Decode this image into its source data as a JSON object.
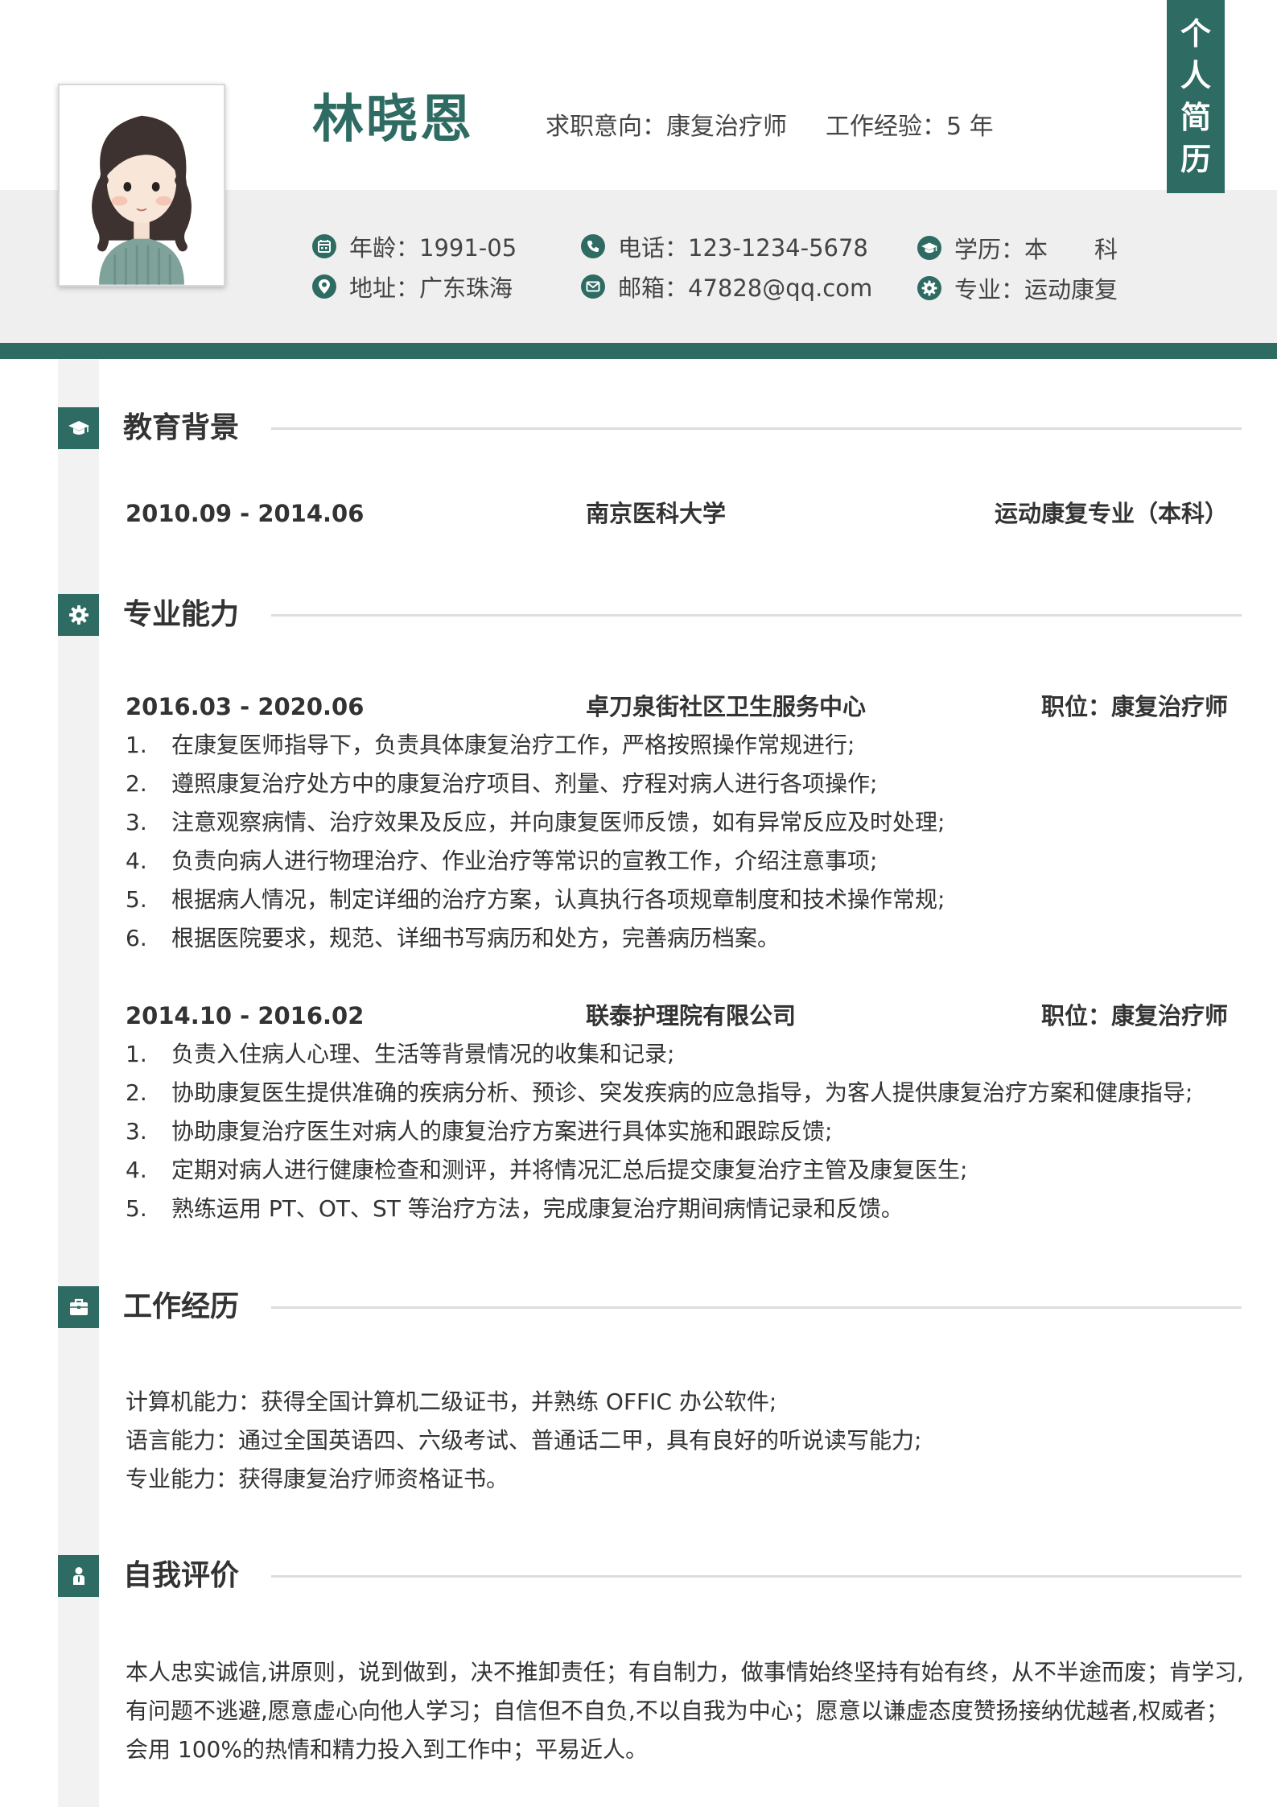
{
  "header": {
    "name": "林晓恩",
    "intent": "求职意向：康复治疗师",
    "experience": "工作经验：5 年",
    "tag": [
      "个",
      "人",
      "简",
      "历"
    ],
    "info": [
      {
        "icon": "calendar-icon",
        "text": "年龄：1991-05"
      },
      {
        "icon": "location-pin-icon",
        "text": "地址：广东珠海"
      },
      {
        "icon": "phone-icon",
        "text": "电话：123-1234-5678"
      },
      {
        "icon": "envelope-icon",
        "text": "邮箱：47828@qq.com"
      },
      {
        "icon": "graduation-cap-icon",
        "text": "学历：本　　科"
      },
      {
        "icon": "gear-icon",
        "text": "专业：运动康复"
      }
    ]
  },
  "sections": {
    "education": {
      "title": "教育背景",
      "icon": "graduation-cap-icon",
      "period": "2010.09 - 2014.06",
      "school": "南京医科大学",
      "major": "运动康复专业（本科）"
    },
    "skills": {
      "title": "专业能力",
      "icon": "gear-icon",
      "jobs": [
        {
          "period": "2016.03 - 2020.06",
          "company": "卓刀泉街社区卫生服务中心",
          "position": "职位：康复治疗师",
          "items": [
            {
              "num": "1.",
              "text": "在康复医师指导下，负责具体康复治疗工作，严格按照操作常规进行;"
            },
            {
              "num": "2.",
              "text": "遵照康复治疗处方中的康复治疗项目、剂量、疗程对病人进行各项操作;"
            },
            {
              "num": "3.",
              "text": "注意观察病情、治疗效果及反应，并向康复医师反馈，如有异常反应及时处理;"
            },
            {
              "num": "4.",
              "text": "负责向病人进行物理治疗、作业治疗等常识的宣教工作，介绍注意事项;"
            },
            {
              "num": "5.",
              "text": "根据病人情况，制定详细的治疗方案，认真执行各项规章制度和技术操作常规;"
            },
            {
              "num": "6.",
              "text": "根据医院要求，规范、详细书写病历和处方，完善病历档案。"
            }
          ]
        },
        {
          "period": "2014.10 - 2016.02",
          "company": "联泰护理院有限公司",
          "position": "职位：康复治疗师",
          "items": [
            {
              "num": "1.",
              "text": "负责入住病人心理、生活等背景情况的收集和记录;"
            },
            {
              "num": "2.",
              "text": "协助康复医生提供准确的疾病分析、预诊、突发疾病的应急指导，为客人提供康复治疗方案和健康指导;"
            },
            {
              "num": "3.",
              "text": "协助康复治疗医生对病人的康复治疗方案进行具体实施和跟踪反馈;"
            },
            {
              "num": "4.",
              "text": "定期对病人进行健康检查和测评，并将情况汇总后提交康复治疗主管及康复医生;"
            },
            {
              "num": "5.",
              "text": "熟练运用 PT、OT、ST 等治疗方法，完成康复治疗期间病情记录和反馈。"
            }
          ]
        }
      ]
    },
    "work": {
      "title": "工作经历",
      "icon": "briefcase-icon",
      "lines": [
        "计算机能力：获得全国计算机二级证书，并熟练 OFFIC 办公软件;",
        "语言能力：通过全国英语四、六级考试、普通话二甲，具有良好的听说读写能力;",
        "专业能力：获得康复治疗师资格证书。"
      ]
    },
    "self": {
      "title": "自我评价",
      "icon": "person-icon",
      "lines": [
        "本人忠实诚信,讲原则，说到做到，决不推卸责任；有自制力，做事情始终坚持有始有终，从不半途而废；肯学习,",
        "有问题不逃避,愿意虚心向他人学习；自信但不自负,不以自我为中心；愿意以谦虚态度赞扬接纳优越者,权威者；",
        "会用 100%的热情和精力投入到工作中；平易近人。"
      ]
    }
  },
  "colors": {
    "accent": "#2e6b63",
    "band": "#efefef",
    "text": "#333333"
  }
}
